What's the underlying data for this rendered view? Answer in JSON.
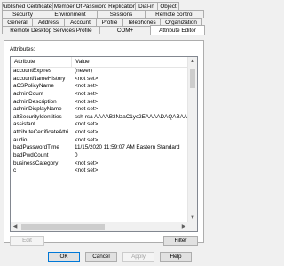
{
  "tabs": {
    "row1": [
      {
        "label": "Published Certificates",
        "width": 58
      },
      {
        "label": "Member Of",
        "width": 35
      },
      {
        "label": "Password Replication",
        "width": 60
      },
      {
        "label": "Dial-in",
        "width": 26
      },
      {
        "label": "Object",
        "width": 25
      }
    ],
    "row2": [
      {
        "label": "Security",
        "width": 47
      },
      {
        "label": "Environment",
        "width": 62
      },
      {
        "label": "Sessions",
        "width": 55
      },
      {
        "label": "Remote control",
        "width": 62
      }
    ],
    "row3": [
      {
        "label": "General"
      },
      {
        "label": "Address"
      },
      {
        "label": "Account"
      },
      {
        "label": "Profile"
      },
      {
        "label": "Telephones"
      },
      {
        "label": "Organization"
      }
    ],
    "row4": [
      {
        "label": "Remote Desktop Services Profile"
      },
      {
        "label": "COM+"
      },
      {
        "label": "Attribute Editor",
        "active": true
      }
    ]
  },
  "attributes_label": "Attributes:",
  "table": {
    "columns": [
      "Attribute",
      "Value"
    ],
    "rows": [
      {
        "attribute": "accountExpires",
        "value": "(never)"
      },
      {
        "attribute": "accountNameHistory",
        "value": "<not set>"
      },
      {
        "attribute": "aCSPolicyName",
        "value": "<not set>"
      },
      {
        "attribute": "adminCount",
        "value": "<not set>"
      },
      {
        "attribute": "adminDescription",
        "value": "<not set>"
      },
      {
        "attribute": "adminDisplayName",
        "value": "<not set>"
      },
      {
        "attribute": "altSecurityIdentities",
        "value": "ssh-rsa AAAAB3NzaC1yc2EAAAADAQABAAAI"
      },
      {
        "attribute": "assistant",
        "value": "<not set>"
      },
      {
        "attribute": "attributeCertificateAttri...",
        "value": "<not set>"
      },
      {
        "attribute": "audio",
        "value": "<not set>"
      },
      {
        "attribute": "badPasswordTime",
        "value": "11/15/2020 11:59:07 AM Eastern Standard"
      },
      {
        "attribute": "badPwdCount",
        "value": "0"
      },
      {
        "attribute": "businessCategory",
        "value": "<not set>"
      },
      {
        "attribute": "c",
        "value": "<not set>"
      }
    ]
  },
  "buttons": {
    "edit": "Edit",
    "filter": "Filter",
    "ok": "OK",
    "cancel": "Cancel",
    "apply": "Apply",
    "help": "Help"
  }
}
